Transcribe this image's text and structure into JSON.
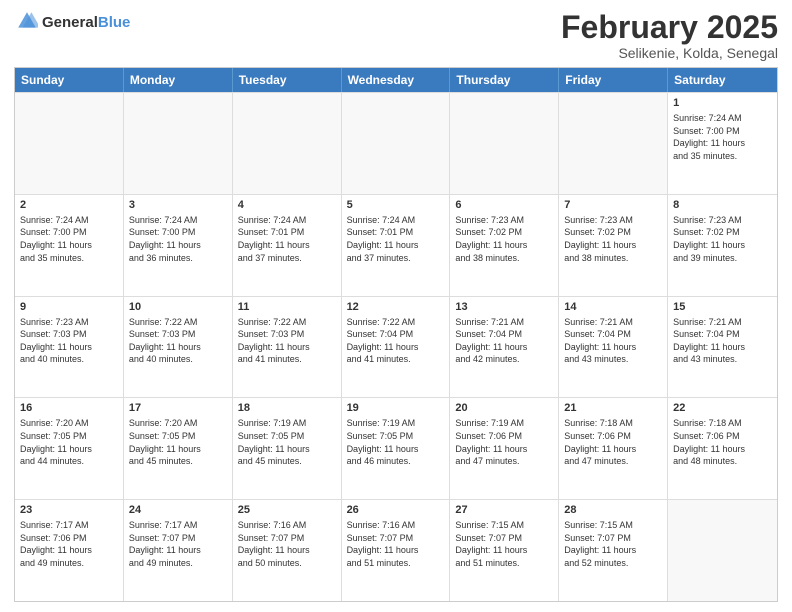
{
  "header": {
    "logo_general": "General",
    "logo_blue": "Blue",
    "month_year": "February 2025",
    "location": "Selikenie, Kolda, Senegal"
  },
  "days_of_week": [
    "Sunday",
    "Monday",
    "Tuesday",
    "Wednesday",
    "Thursday",
    "Friday",
    "Saturday"
  ],
  "weeks": [
    [
      {
        "day": "",
        "text": ""
      },
      {
        "day": "",
        "text": ""
      },
      {
        "day": "",
        "text": ""
      },
      {
        "day": "",
        "text": ""
      },
      {
        "day": "",
        "text": ""
      },
      {
        "day": "",
        "text": ""
      },
      {
        "day": "1",
        "text": "Sunrise: 7:24 AM\nSunset: 7:00 PM\nDaylight: 11 hours\nand 35 minutes."
      }
    ],
    [
      {
        "day": "2",
        "text": "Sunrise: 7:24 AM\nSunset: 7:00 PM\nDaylight: 11 hours\nand 35 minutes."
      },
      {
        "day": "3",
        "text": "Sunrise: 7:24 AM\nSunset: 7:00 PM\nDaylight: 11 hours\nand 36 minutes."
      },
      {
        "day": "4",
        "text": "Sunrise: 7:24 AM\nSunset: 7:01 PM\nDaylight: 11 hours\nand 37 minutes."
      },
      {
        "day": "5",
        "text": "Sunrise: 7:24 AM\nSunset: 7:01 PM\nDaylight: 11 hours\nand 37 minutes."
      },
      {
        "day": "6",
        "text": "Sunrise: 7:23 AM\nSunset: 7:02 PM\nDaylight: 11 hours\nand 38 minutes."
      },
      {
        "day": "7",
        "text": "Sunrise: 7:23 AM\nSunset: 7:02 PM\nDaylight: 11 hours\nand 38 minutes."
      },
      {
        "day": "8",
        "text": "Sunrise: 7:23 AM\nSunset: 7:02 PM\nDaylight: 11 hours\nand 39 minutes."
      }
    ],
    [
      {
        "day": "9",
        "text": "Sunrise: 7:23 AM\nSunset: 7:03 PM\nDaylight: 11 hours\nand 40 minutes."
      },
      {
        "day": "10",
        "text": "Sunrise: 7:22 AM\nSunset: 7:03 PM\nDaylight: 11 hours\nand 40 minutes."
      },
      {
        "day": "11",
        "text": "Sunrise: 7:22 AM\nSunset: 7:03 PM\nDaylight: 11 hours\nand 41 minutes."
      },
      {
        "day": "12",
        "text": "Sunrise: 7:22 AM\nSunset: 7:04 PM\nDaylight: 11 hours\nand 41 minutes."
      },
      {
        "day": "13",
        "text": "Sunrise: 7:21 AM\nSunset: 7:04 PM\nDaylight: 11 hours\nand 42 minutes."
      },
      {
        "day": "14",
        "text": "Sunrise: 7:21 AM\nSunset: 7:04 PM\nDaylight: 11 hours\nand 43 minutes."
      },
      {
        "day": "15",
        "text": "Sunrise: 7:21 AM\nSunset: 7:04 PM\nDaylight: 11 hours\nand 43 minutes."
      }
    ],
    [
      {
        "day": "16",
        "text": "Sunrise: 7:20 AM\nSunset: 7:05 PM\nDaylight: 11 hours\nand 44 minutes."
      },
      {
        "day": "17",
        "text": "Sunrise: 7:20 AM\nSunset: 7:05 PM\nDaylight: 11 hours\nand 45 minutes."
      },
      {
        "day": "18",
        "text": "Sunrise: 7:19 AM\nSunset: 7:05 PM\nDaylight: 11 hours\nand 45 minutes."
      },
      {
        "day": "19",
        "text": "Sunrise: 7:19 AM\nSunset: 7:05 PM\nDaylight: 11 hours\nand 46 minutes."
      },
      {
        "day": "20",
        "text": "Sunrise: 7:19 AM\nSunset: 7:06 PM\nDaylight: 11 hours\nand 47 minutes."
      },
      {
        "day": "21",
        "text": "Sunrise: 7:18 AM\nSunset: 7:06 PM\nDaylight: 11 hours\nand 47 minutes."
      },
      {
        "day": "22",
        "text": "Sunrise: 7:18 AM\nSunset: 7:06 PM\nDaylight: 11 hours\nand 48 minutes."
      }
    ],
    [
      {
        "day": "23",
        "text": "Sunrise: 7:17 AM\nSunset: 7:06 PM\nDaylight: 11 hours\nand 49 minutes."
      },
      {
        "day": "24",
        "text": "Sunrise: 7:17 AM\nSunset: 7:07 PM\nDaylight: 11 hours\nand 49 minutes."
      },
      {
        "day": "25",
        "text": "Sunrise: 7:16 AM\nSunset: 7:07 PM\nDaylight: 11 hours\nand 50 minutes."
      },
      {
        "day": "26",
        "text": "Sunrise: 7:16 AM\nSunset: 7:07 PM\nDaylight: 11 hours\nand 51 minutes."
      },
      {
        "day": "27",
        "text": "Sunrise: 7:15 AM\nSunset: 7:07 PM\nDaylight: 11 hours\nand 51 minutes."
      },
      {
        "day": "28",
        "text": "Sunrise: 7:15 AM\nSunset: 7:07 PM\nDaylight: 11 hours\nand 52 minutes."
      },
      {
        "day": "",
        "text": ""
      }
    ]
  ]
}
